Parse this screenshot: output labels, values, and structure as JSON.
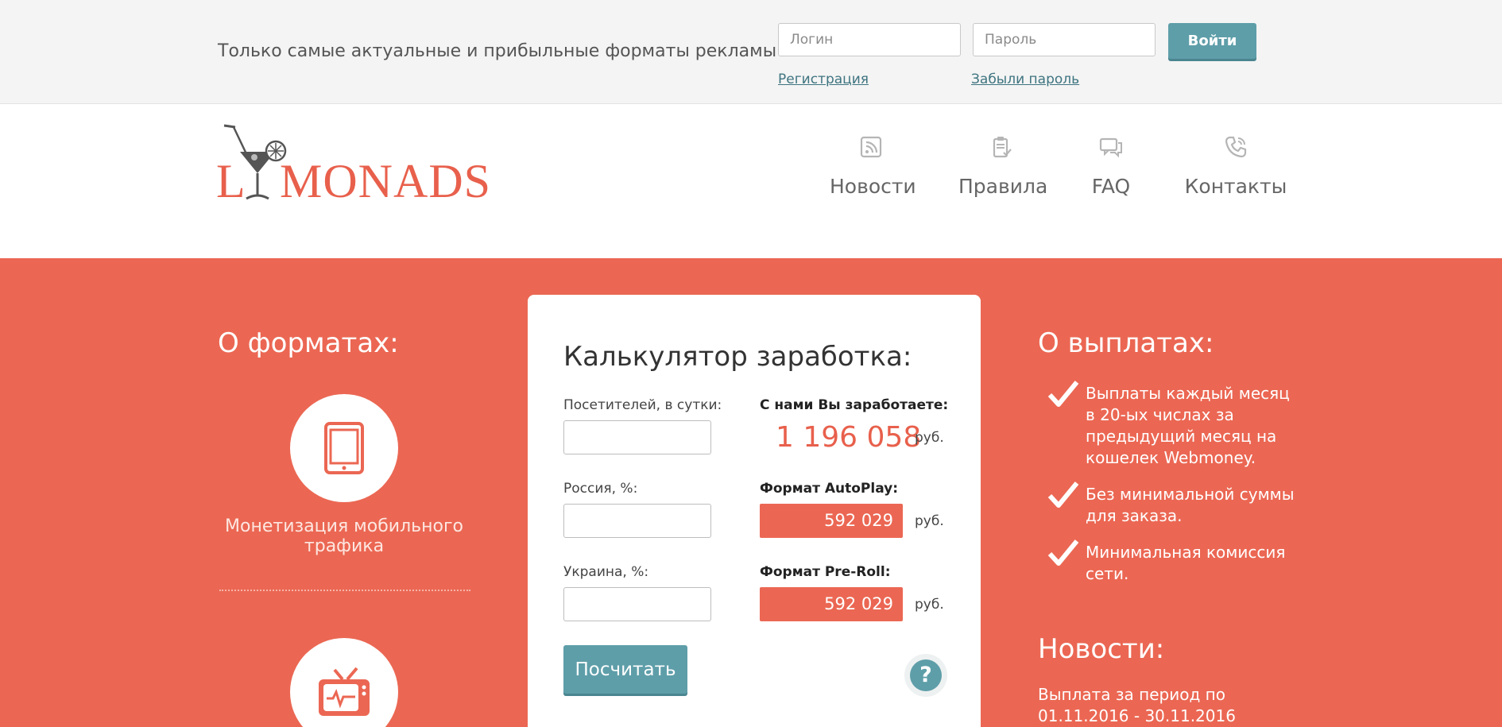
{
  "topbar": {
    "tagline": "Только самые актуальные и прибыльные форматы рекламы",
    "login_placeholder": "Логин",
    "password_placeholder": "Пароль",
    "login_button": "Войти",
    "register_link": "Регистрация",
    "forgot_link": "Забыли пароль"
  },
  "brand": {
    "logo_text": "LIMONADS",
    "logo_color": "#e8604c"
  },
  "nav": {
    "items": [
      {
        "label": "Новости",
        "icon": "rss-icon"
      },
      {
        "label": "Правила",
        "icon": "clipboard-icon"
      },
      {
        "label": "FAQ",
        "icon": "chat-bubbles-icon"
      },
      {
        "label": "Контакты",
        "icon": "phone-icon"
      }
    ]
  },
  "formats": {
    "heading": "О форматах:",
    "items": [
      {
        "icon": "tablet-icon",
        "caption": "Монетизация мобильного трафика"
      },
      {
        "icon": "tv-icon",
        "caption": ""
      }
    ]
  },
  "calculator": {
    "title": "Калькулятор заработка:",
    "visitors_label": "Посетителей, в сутки:",
    "russia_label": "Россия, %:",
    "ukraine_label": "Украина, %:",
    "earn_label": "С нами Вы заработаете:",
    "total_value": "1 196 058",
    "currency": "руб.",
    "autoplay_label": "Формат AutoPlay:",
    "autoplay_value": "592 029",
    "preroll_label": "Формат Pre-Roll:",
    "preroll_value": "592 029",
    "calc_button": "Посчитать",
    "help_symbol": "?"
  },
  "payouts": {
    "heading": "О выплатах:",
    "items": [
      "Выплаты каждый месяц в 20-ых числах за предыдущий месяц на кошелек Webmoney.",
      "Без минимальной суммы для заказа.",
      "Минимальная комиссия сети."
    ]
  },
  "news": {
    "heading": "Новости:",
    "first_item": "Выплата за период по 01.11.2016 - 30.11.2016"
  },
  "colors": {
    "accent_red": "#eb6753",
    "accent_teal": "#5e9ea9"
  }
}
